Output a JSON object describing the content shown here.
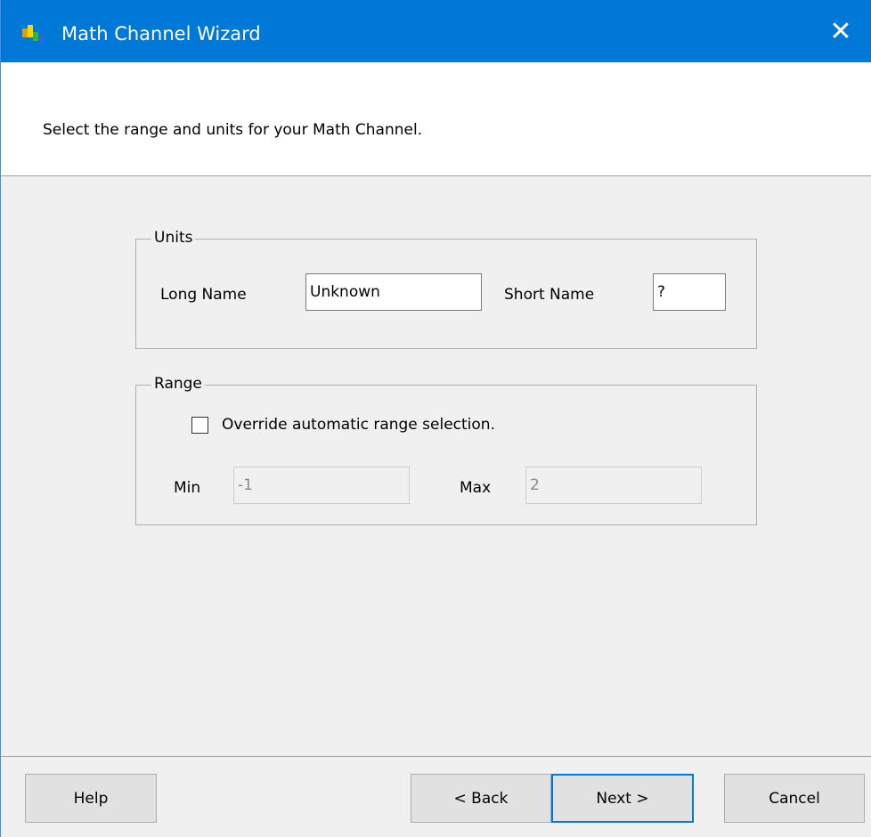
{
  "window": {
    "title": "Math Channel Wizard"
  },
  "header": {
    "instruction": "Select the range and units for your Math Channel."
  },
  "units": {
    "legend": "Units",
    "long_name_label": "Long Name",
    "long_name_value": "Unknown",
    "short_name_label": "Short Name",
    "short_name_value": "?"
  },
  "range": {
    "legend": "Range",
    "override_label": "Override automatic range selection.",
    "override_checked": false,
    "min_label": "Min",
    "min_value": "-1",
    "max_label": "Max",
    "max_value": "2"
  },
  "buttons": {
    "help": "Help",
    "back": "< Back",
    "next": "Next >",
    "cancel": "Cancel"
  },
  "colors": {
    "titlebar": "#0078d7",
    "accent": "#0078d7"
  },
  "icons": {
    "app": "math-channel-icon",
    "close": "close-icon"
  }
}
